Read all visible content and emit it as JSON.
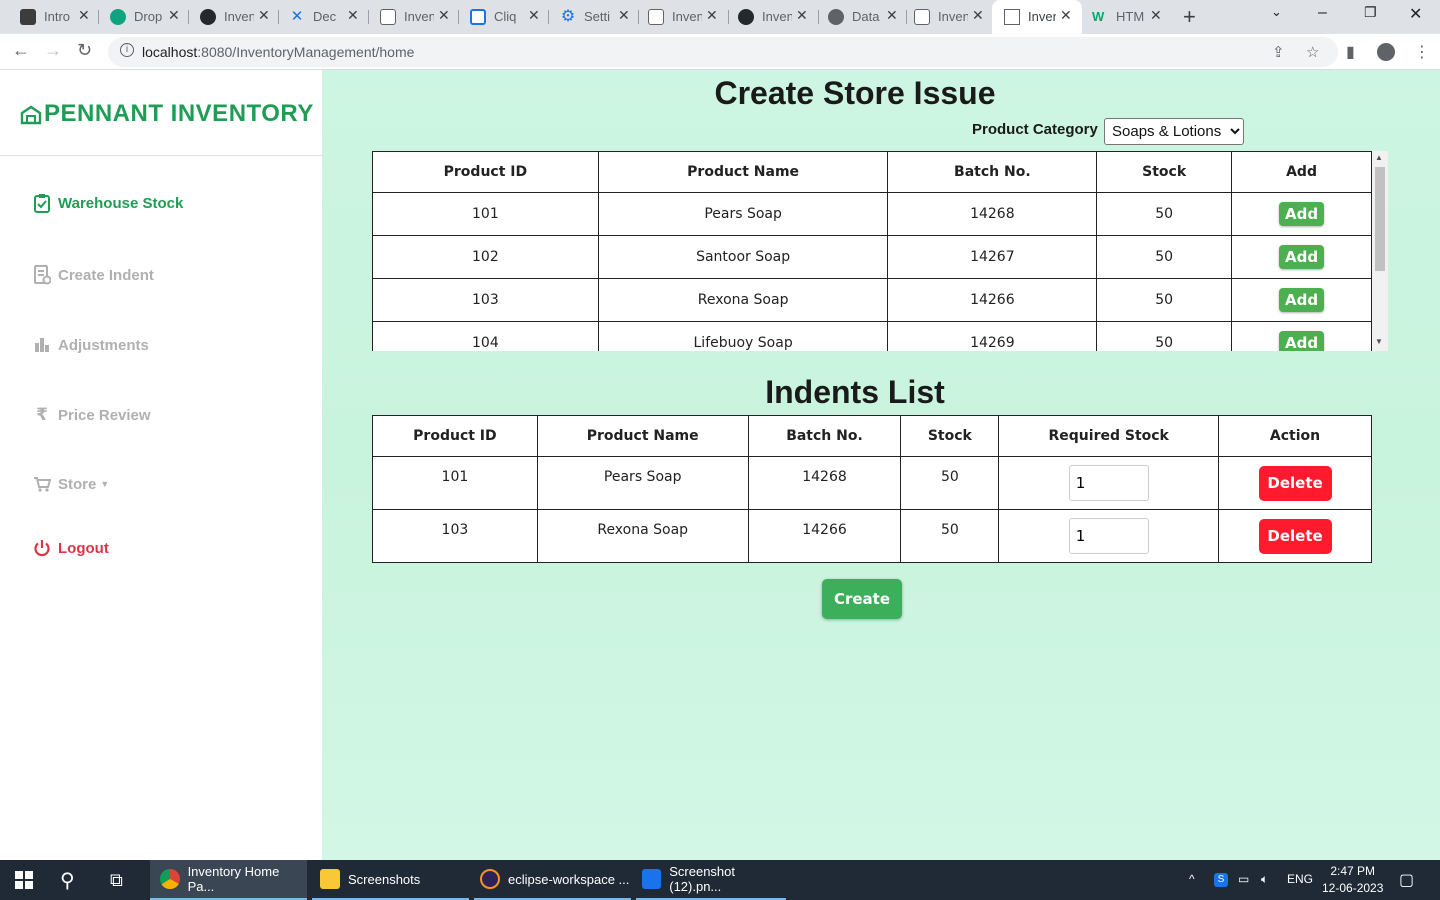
{
  "browser": {
    "tabs": [
      {
        "label": "Intro",
        "icon": "app-icon",
        "color": "#3c3c3c"
      },
      {
        "label": "Drop",
        "icon": "chatgpt-icon",
        "color": "#10a37f"
      },
      {
        "label": "Inven",
        "icon": "github-icon",
        "color": "#24292e"
      },
      {
        "label": "Dec",
        "icon": "tools-icon",
        "color": "#1a73e8"
      },
      {
        "label": "Inven",
        "icon": "page-icon",
        "color": "#5f6368"
      },
      {
        "label": "Cliq",
        "icon": "cliq-icon",
        "color": "#1a73e8"
      },
      {
        "label": "Setti",
        "icon": "gear-icon",
        "color": "#1a73e8"
      },
      {
        "label": "Inven",
        "icon": "page-icon",
        "color": "#5f6368"
      },
      {
        "label": "Inven",
        "icon": "github-icon",
        "color": "#24292e"
      },
      {
        "label": "Data",
        "icon": "globe-icon",
        "color": "#5f6368"
      },
      {
        "label": "Inven",
        "icon": "page-icon",
        "color": "#5f6368"
      },
      {
        "label": "Inven",
        "icon": "page-icon",
        "color": "#5f6368",
        "active": true
      },
      {
        "label": "HTM",
        "icon": "w3-icon",
        "color": "#04aa6d"
      }
    ],
    "url_host": "localhost",
    "url_rest": ":8080/InventoryManagement/home"
  },
  "sidebar": {
    "brand": "PENNANT INVENTORY",
    "brand_color": "#1f9d55",
    "items": [
      {
        "label": "Warehouse Stock",
        "icon": "clipboard-check-icon",
        "active": true
      },
      {
        "label": "Create Indent",
        "icon": "document-icon"
      },
      {
        "label": "Adjustments",
        "icon": "bar-chart-icon"
      },
      {
        "label": "Price Review",
        "icon": "rupee-icon"
      },
      {
        "label": "Store",
        "icon": "cart-icon",
        "dropdown": true
      },
      {
        "label": "Logout",
        "icon": "power-icon",
        "logout": true
      }
    ]
  },
  "main": {
    "title": "Create Store Issue",
    "category_label": "Product Category",
    "category_selected": "Soaps & Lotions",
    "products": {
      "columns": [
        "Product ID",
        "Product Name",
        "Batch No.",
        "Stock",
        "Add"
      ],
      "rows": [
        {
          "id": "101",
          "name": "Pears Soap",
          "batch": "14268",
          "stock": "50",
          "action": "Add"
        },
        {
          "id": "102",
          "name": "Santoor Soap",
          "batch": "14267",
          "stock": "50",
          "action": "Add"
        },
        {
          "id": "103",
          "name": "Rexona Soap",
          "batch": "14266",
          "stock": "50",
          "action": "Add"
        },
        {
          "id": "104",
          "name": "Lifebuoy Soap",
          "batch": "14269",
          "stock": "50",
          "action": "Add"
        }
      ]
    },
    "indents_title": "Indents List",
    "indents": {
      "columns": [
        "Product ID",
        "Product Name",
        "Batch No.",
        "Stock",
        "Required Stock",
        "Action"
      ],
      "rows": [
        {
          "id": "101",
          "name": "Pears Soap",
          "batch": "14268",
          "stock": "50",
          "required": "1",
          "action": "Delete"
        },
        {
          "id": "103",
          "name": "Rexona Soap",
          "batch": "14266",
          "stock": "50",
          "required": "1",
          "action": "Delete"
        }
      ]
    },
    "create_label": "Create",
    "colors": {
      "add": "#4caf50",
      "delete": "#ff1a2e",
      "create": "#3daf5c",
      "background": "#c8f3dc"
    }
  },
  "taskbar": {
    "items": [
      {
        "label": "Inventory Home Pa...",
        "icon": "chrome-icon",
        "active": true
      },
      {
        "label": "Screenshots",
        "icon": "folder-icon"
      },
      {
        "label": "eclipse-workspace ...",
        "icon": "eclipse-icon"
      },
      {
        "label": "Screenshot (12).pn...",
        "icon": "photos-icon"
      }
    ],
    "language": "ENG",
    "time": "2:47 PM",
    "date": "12-06-2023"
  }
}
